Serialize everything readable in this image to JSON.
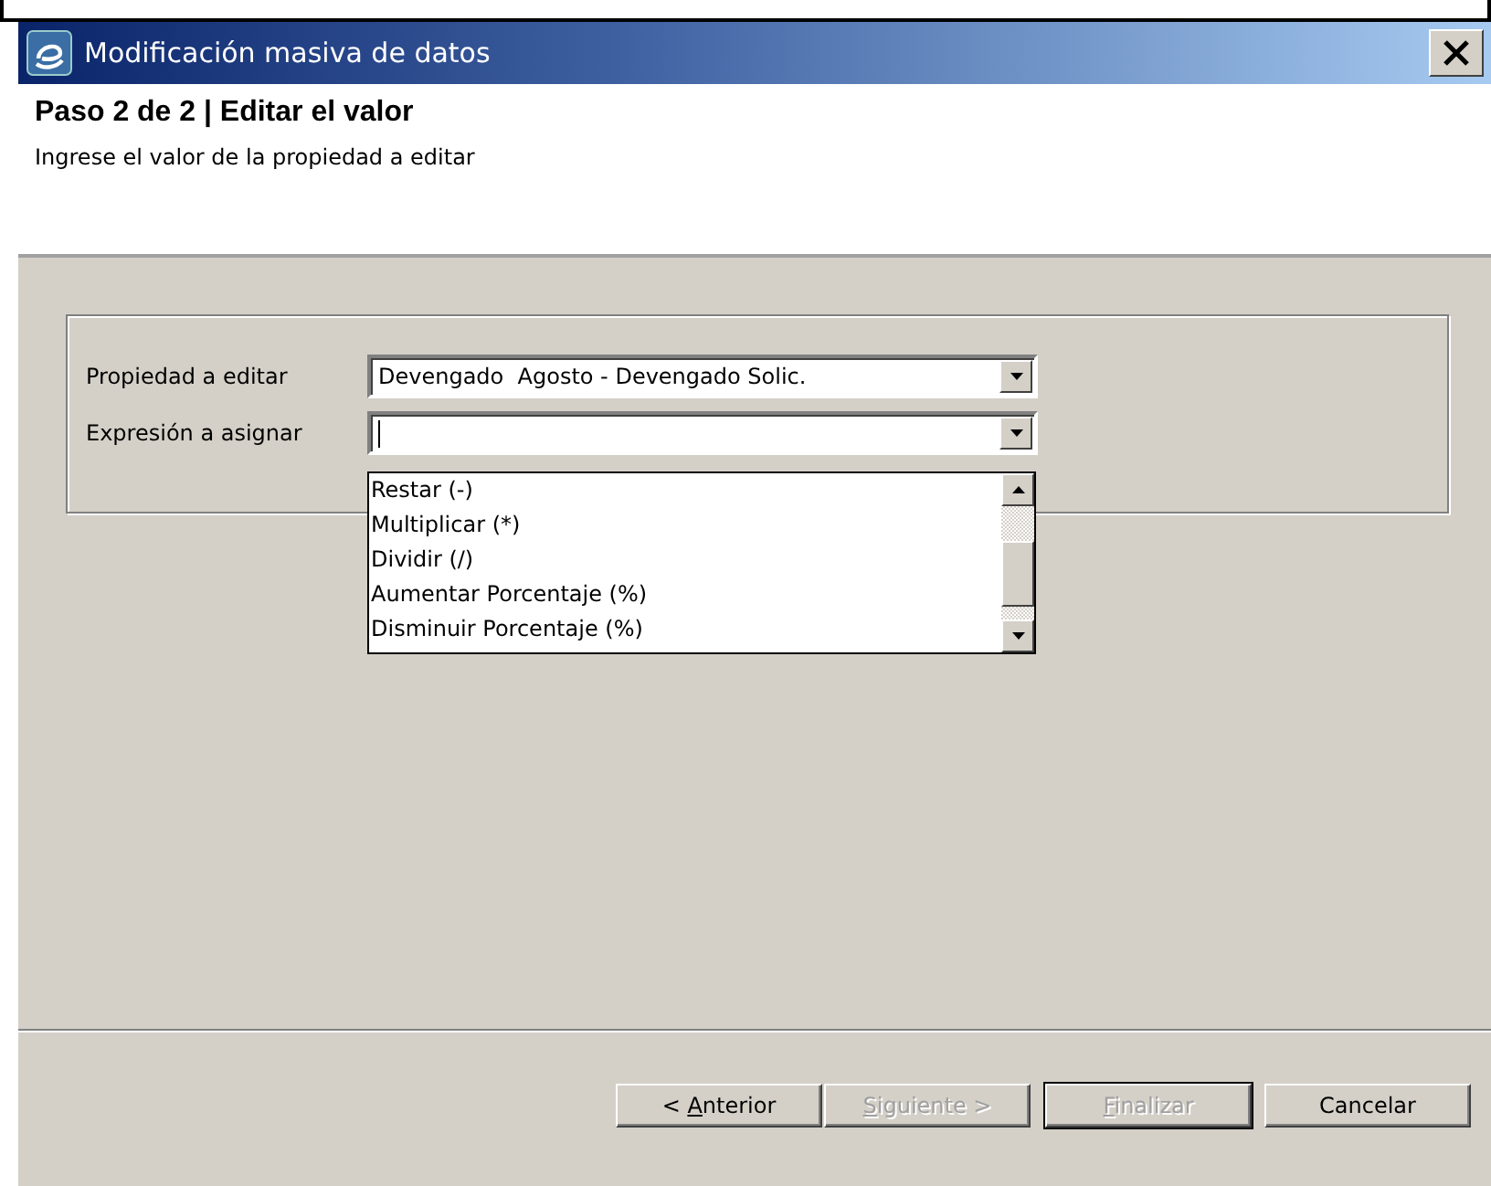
{
  "window": {
    "title": "Modificación masiva de datos"
  },
  "header": {
    "title": "Paso 2 de 2 | Editar el valor",
    "subtitle": "Ingrese el valor de la propiedad a editar"
  },
  "fields": [
    {
      "label": "Propiedad a editar",
      "value": "Devengado  Agosto - Devengado Solic.",
      "focused": false
    },
    {
      "label": "Expresión a asignar",
      "focused": true
    }
  ],
  "dropdown_list": {
    "items": [
      {
        "label": "Restar (-)",
        "selected": false
      },
      {
        "label": "Multiplicar (*)",
        "selected": false
      },
      {
        "label": "Dividir (/)",
        "selected": false
      },
      {
        "label": "Aumentar Porcentaje (%)",
        "selected": false
      },
      {
        "label": "Disminuir Porcentaje (%)",
        "selected": false
      }
    ]
  },
  "buttons": [
    {
      "label_parts": [
        {
          "text": "< ",
          "underlined": false
        },
        {
          "text": "A",
          "underlined": true
        },
        {
          "text": "nterior",
          "underlined": false
        }
      ],
      "disabled": false,
      "default": false
    },
    {
      "label_parts": [
        {
          "text": "S",
          "underlined": true
        },
        {
          "text": "iguiente >",
          "underlined": false
        }
      ],
      "disabled": true,
      "default": false
    },
    {
      "label_parts": [
        {
          "text": "F",
          "underlined": true
        },
        {
          "text": "inalizar",
          "underlined": false
        }
      ],
      "disabled": true,
      "default": true
    },
    {
      "label_parts": [
        {
          "text": "Cancelar",
          "underlined": false
        }
      ],
      "disabled": false,
      "default": false
    }
  ]
}
